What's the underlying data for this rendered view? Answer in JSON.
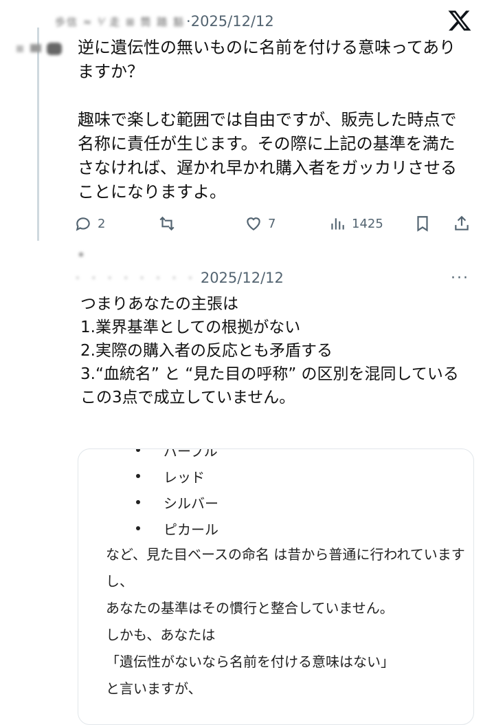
{
  "post1": {
    "handle": "歩信 ≈ ⅟ 走 ⊞ 筒 踏 豁",
    "date": "·2025/12/12",
    "text": "逆に遺伝性の無いものに名前を付ける意味ってありますか？\n\n趣味で楽しむ範囲では自由ですが、販売した時点で名称に責任が生じます。その際に上記の基準を満たさなければ、遅かれ早かれ購入者をガッカリさせることになりますよ。",
    "actions": {
      "replies": "2",
      "likes": "7",
      "views": "1425"
    }
  },
  "post2": {
    "handle": "·  ·  ·  ·  ·  ·  ·  ·",
    "date": "2025/12/12",
    "text": "つまりあなたの主張は\n1.業界基準としての根拠がない\n2.実際の購入者の反応とも矛盾する\n3.“血統名” と “見た目の呼称” の区別を混同している\nこの3点で成立していません。",
    "more": "···"
  },
  "quote": {
    "bullets": [
      "パープル",
      "レッド",
      "シルバー",
      "ピカール"
    ],
    "text": "など、見た目ベースの命名 は昔から普通に行われていますし、\nあなたの基準はその慣行と整合していません。\nしかも、あなたは\n「遺伝性がないなら名前を付ける意味はない」\nと言いますが、"
  },
  "colors": {
    "muted": "#536471",
    "thread_line": "#cfd9de",
    "card_border": "#e1e6ea"
  }
}
